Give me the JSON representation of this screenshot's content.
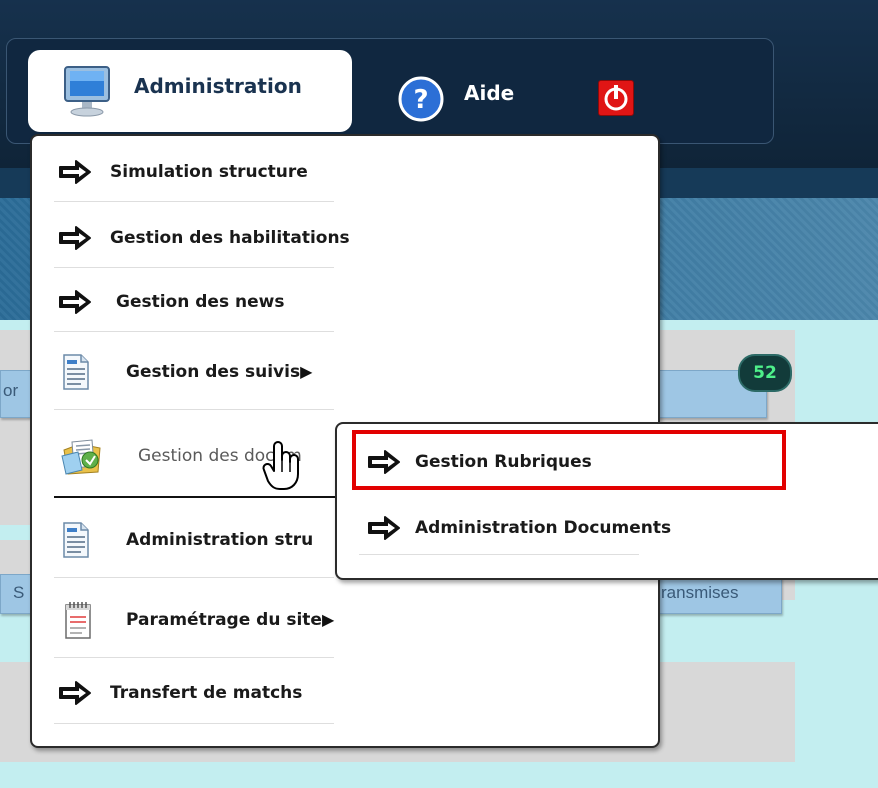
{
  "nav": {
    "administration_label": "Administration",
    "help_label": "Aide",
    "help_icon": "question-icon",
    "power_icon": "power-icon"
  },
  "menu": {
    "items": [
      {
        "label": "Simulation structure",
        "icon": "arrow-right-icon",
        "has_submenu": false
      },
      {
        "label": "Gestion des habilitations",
        "icon": "arrow-right-icon",
        "has_submenu": false
      },
      {
        "label": "Gestion des news",
        "icon": "arrow-right-icon",
        "has_submenu": false
      },
      {
        "label": "Gestion des suivis",
        "icon": "document-icon",
        "has_submenu": true
      },
      {
        "label": "Gestion des docum",
        "icon": "folder-documents-icon",
        "has_submenu": true,
        "state": "hovered"
      },
      {
        "label": "Administration stru",
        "icon": "document-icon",
        "has_submenu": false
      },
      {
        "label": "Paramétrage du site",
        "icon": "notepad-icon",
        "has_submenu": true
      },
      {
        "label": "Transfert de matchs",
        "icon": "arrow-right-icon",
        "has_submenu": false
      }
    ],
    "submenu_indicator": "▶"
  },
  "submenu": {
    "items": [
      {
        "label": "Gestion Rubriques",
        "icon": "arrow-right-icon",
        "highlighted": true
      },
      {
        "label": "Administration Documents",
        "icon": "arrow-right-icon",
        "highlighted": false
      }
    ]
  },
  "background": {
    "badge_count": "52",
    "tab_left_fragment": "or",
    "tab_s_fragment": "S",
    "tab_right_fragment": "ransmises"
  },
  "colors": {
    "topbar": "#16314d",
    "banner": "#3b7aa3",
    "content": "#c3eef0",
    "highlight": "#e20000",
    "text": "#1a3350"
  }
}
